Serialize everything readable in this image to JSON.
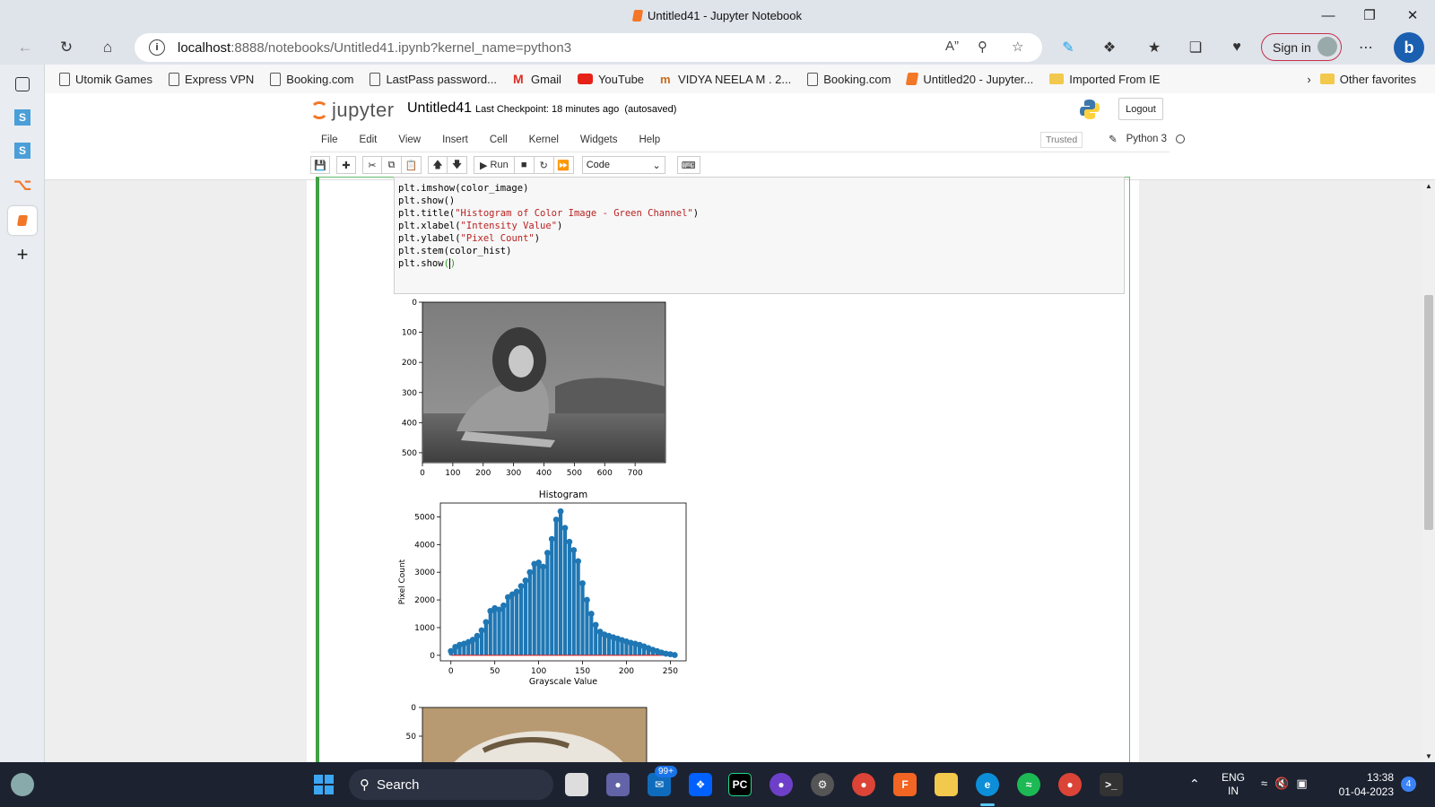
{
  "window": {
    "title": "Untitled41 - Jupyter Notebook"
  },
  "browser": {
    "url_host": "localhost",
    "url_rest": ":8888/notebooks/Untitled41.ipynb?kernel_name=python3",
    "sign_in": "Sign in"
  },
  "bookmarks": [
    {
      "label": "Utomik Games",
      "icon": "page-icon"
    },
    {
      "label": "Express VPN",
      "icon": "page-icon"
    },
    {
      "label": "Booking.com",
      "icon": "page-icon"
    },
    {
      "label": "LastPass password...",
      "icon": "page-icon"
    },
    {
      "label": "Gmail",
      "icon": "gmail-icon"
    },
    {
      "label": "YouTube",
      "icon": "youtube-icon"
    },
    {
      "label": "VIDYA NEELA M . 2...",
      "icon": "vidya-icon"
    },
    {
      "label": "Booking.com",
      "icon": "page-icon"
    },
    {
      "label": "Untitled20 - Jupyter...",
      "icon": "jupyter-icon"
    },
    {
      "label": "Imported From IE",
      "icon": "folder-icon"
    }
  ],
  "other_favorites": "Other favorites",
  "jupyter": {
    "logo_text": "jupyter",
    "notebook_name": "Untitled41",
    "checkpoint_label": "Last Checkpoint:",
    "checkpoint_time": "18 minutes ago",
    "autosaved": "(autosaved)",
    "logout": "Logout",
    "menus": [
      "File",
      "Edit",
      "View",
      "Insert",
      "Cell",
      "Kernel",
      "Widgets",
      "Help"
    ],
    "trusted": "Trusted",
    "kernel": "Python 3",
    "run_label": "Run",
    "cell_type": "Code"
  },
  "code_lines": [
    {
      "pre": "plt.imshow(color_image)",
      "str": "",
      "post": ""
    },
    {
      "pre": "plt.show()",
      "str": "",
      "post": ""
    },
    {
      "pre": "plt.title(",
      "str": "\"Histogram of Color Image - Green Channel\"",
      "post": ")"
    },
    {
      "pre": "plt.xlabel(",
      "str": "\"Intensity Value\"",
      "post": ")"
    },
    {
      "pre": "plt.ylabel(",
      "str": "\"Pixel Count\"",
      "post": ")"
    },
    {
      "pre": "plt.stem(color_hist)",
      "str": "",
      "post": ""
    },
    {
      "pre": "plt.show",
      "str": "",
      "post": ""
    }
  ],
  "image_axes": {
    "y_ticks": [
      "0",
      "100",
      "200",
      "300",
      "400",
      "500"
    ],
    "x_ticks": [
      "0",
      "100",
      "200",
      "300",
      "400",
      "500",
      "600",
      "700"
    ]
  },
  "image_axes_2": {
    "y_ticks": [
      "0",
      "50"
    ]
  },
  "chart_data": {
    "type": "bar",
    "title": "Histogram",
    "xlabel": "Grayscale Value",
    "ylabel": "Pixel Count",
    "xlim": [
      -12,
      268
    ],
    "ylim": [
      -200,
      5500
    ],
    "x_ticks": [
      0,
      50,
      100,
      150,
      200,
      250
    ],
    "y_ticks": [
      0,
      1000,
      2000,
      3000,
      4000,
      5000
    ],
    "x": [
      0,
      5,
      10,
      15,
      20,
      25,
      30,
      35,
      40,
      45,
      50,
      55,
      60,
      65,
      70,
      75,
      80,
      85,
      90,
      95,
      100,
      105,
      110,
      115,
      120,
      125,
      130,
      135,
      140,
      145,
      150,
      155,
      160,
      165,
      170,
      175,
      180,
      185,
      190,
      195,
      200,
      205,
      210,
      215,
      220,
      225,
      230,
      235,
      240,
      245,
      250,
      255
    ],
    "values": [
      150,
      300,
      380,
      420,
      480,
      560,
      700,
      900,
      1200,
      1600,
      1700,
      1650,
      1800,
      2100,
      2200,
      2300,
      2500,
      2700,
      3000,
      3300,
      3350,
      3200,
      3700,
      4200,
      4900,
      5200,
      4600,
      4100,
      3800,
      3400,
      2600,
      2000,
      1500,
      1100,
      850,
      750,
      700,
      650,
      600,
      550,
      500,
      450,
      420,
      380,
      320,
      260,
      200,
      150,
      100,
      60,
      40,
      10
    ],
    "color": "#1f77b4",
    "baseline_color": "#d62728"
  },
  "taskbar": {
    "search": "Search",
    "mail_badge": "99+",
    "lang1": "ENG",
    "lang2": "IN",
    "time": "13:38",
    "date": "01-04-2023",
    "notif": "4"
  }
}
